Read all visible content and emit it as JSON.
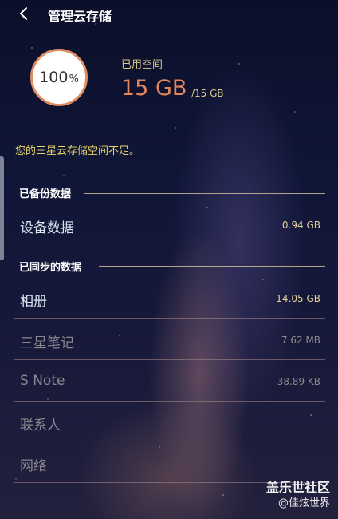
{
  "header": {
    "title": "管理云存储",
    "back_icon": "back-arrow-icon"
  },
  "usage": {
    "percent": "100",
    "percent_sign": "%",
    "used_label": "已用空间",
    "used_value": "15 GB",
    "total": "/15 GB",
    "ring_color": "#e18d62",
    "value_color": "#e5855c"
  },
  "warning": "您的三星云存储空间不足。",
  "backup": {
    "title": "已备份数据",
    "items": [
      {
        "label": "设备数据",
        "value": "0.94 GB"
      }
    ]
  },
  "sync": {
    "title": "已同步的数据",
    "items": [
      {
        "label": "相册",
        "value": "14.05 GB"
      },
      {
        "label": "三星笔记",
        "value": "7.62 MB"
      },
      {
        "label": "S Note",
        "value": "38.89 KB"
      },
      {
        "label": "联系人",
        "value": ""
      },
      {
        "label": "网络",
        "value": ""
      }
    ]
  },
  "watermark": {
    "line1": "盖乐世社区",
    "line2": "@佳炫世界"
  }
}
